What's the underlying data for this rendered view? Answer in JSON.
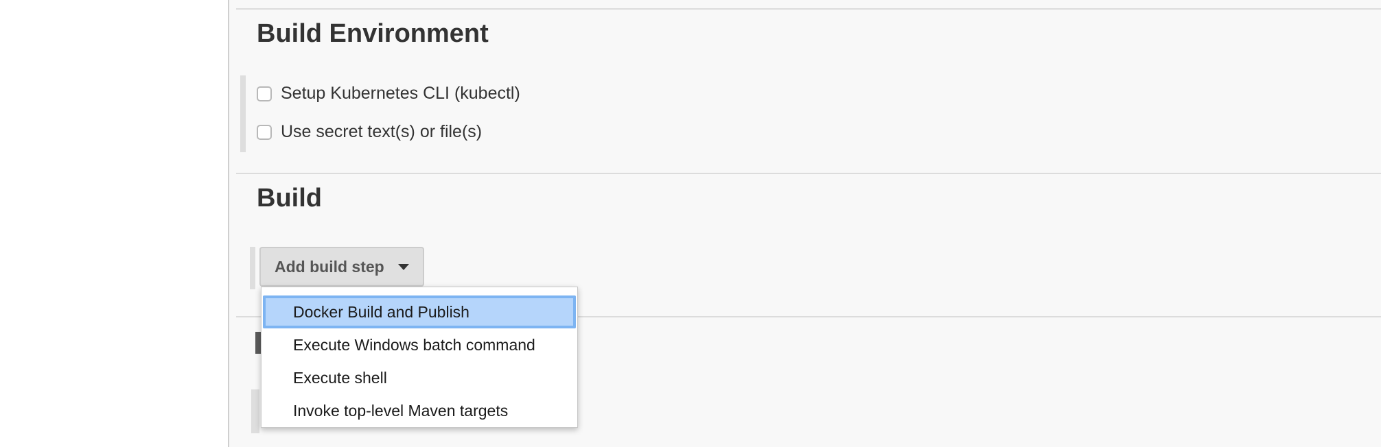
{
  "sections": {
    "build_environment": {
      "title": "Build Environment",
      "options": [
        {
          "label": "Setup Kubernetes CLI (kubectl)",
          "checked": false
        },
        {
          "label": "Use secret text(s) or file(s)",
          "checked": false
        }
      ]
    },
    "build": {
      "title": "Build",
      "add_step_label": "Add build step"
    }
  },
  "dropdown": {
    "items": [
      {
        "label": "Docker Build and Publish",
        "highlighted": true
      },
      {
        "label": "Execute Windows batch command",
        "highlighted": false
      },
      {
        "label": "Execute shell",
        "highlighted": false
      },
      {
        "label": "Invoke top-level Maven targets",
        "highlighted": false
      }
    ]
  },
  "colors": {
    "highlight_fill": "#b5d5fb",
    "highlight_border": "#7db4f2",
    "page_background": "#f8f8f8"
  }
}
